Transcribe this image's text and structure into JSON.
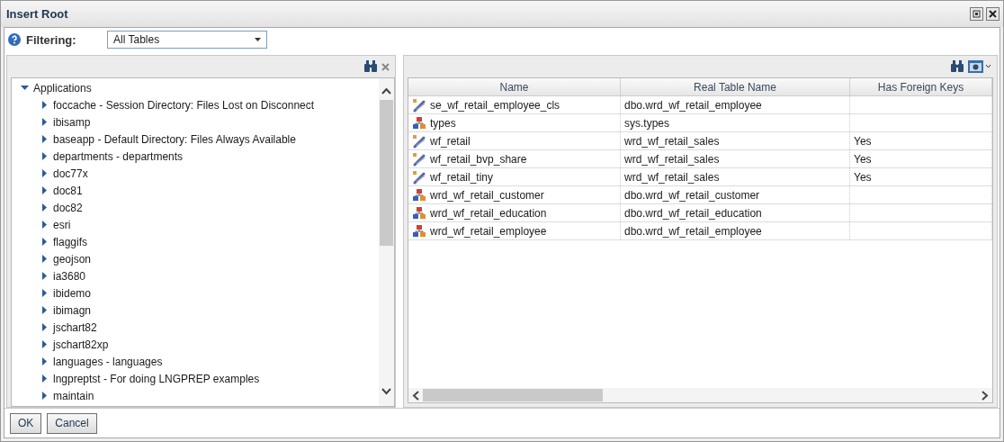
{
  "window": {
    "title": "Insert Root"
  },
  "filter": {
    "label": "Filtering:",
    "value": "All Tables"
  },
  "tree": [
    {
      "label": "Applications",
      "expanded": true,
      "children": [
        {
          "label": "foccache - Session Directory: Files Lost on Disconnect",
          "expanded": false
        },
        {
          "label": "ibisamp",
          "expanded": false
        },
        {
          "label": "baseapp - Default Directory: Files Always Available",
          "expanded": false
        },
        {
          "label": "departments - departments",
          "expanded": false
        },
        {
          "label": "doc77x",
          "expanded": false
        },
        {
          "label": "doc81",
          "expanded": false
        },
        {
          "label": "doc82",
          "expanded": false
        },
        {
          "label": "esri",
          "expanded": false
        },
        {
          "label": "flaggifs",
          "expanded": false
        },
        {
          "label": "geojson",
          "expanded": false
        },
        {
          "label": "ia3680",
          "expanded": false
        },
        {
          "label": "ibidemo",
          "expanded": false
        },
        {
          "label": "ibimagn",
          "expanded": false
        },
        {
          "label": "jschart82",
          "expanded": false
        },
        {
          "label": "jschart82xp",
          "expanded": false
        },
        {
          "label": "languages - languages",
          "expanded": false
        },
        {
          "label": "lngpreptst - For doing LNGPREP examples",
          "expanded": false
        },
        {
          "label": "maintain",
          "expanded": false
        }
      ]
    }
  ],
  "table": {
    "columns": [
      "Name",
      "Real Table Name",
      "Has Foreign Keys"
    ],
    "rows": [
      {
        "kind": "link",
        "cells": [
          "se_wf_retail_employee_cls",
          "dbo.wrd_wf_retail_employee",
          ""
        ]
      },
      {
        "kind": "table",
        "cells": [
          "types",
          "sys.types",
          ""
        ]
      },
      {
        "kind": "link",
        "cells": [
          "wf_retail",
          "wrd_wf_retail_sales",
          "Yes"
        ]
      },
      {
        "kind": "link",
        "cells": [
          "wf_retail_bvp_share",
          "wrd_wf_retail_sales",
          "Yes"
        ]
      },
      {
        "kind": "link",
        "cells": [
          "wf_retail_tiny",
          "wrd_wf_retail_sales",
          "Yes"
        ]
      },
      {
        "kind": "table",
        "cells": [
          "wrd_wf_retail_customer",
          "dbo.wrd_wf_retail_customer",
          ""
        ]
      },
      {
        "kind": "table",
        "cells": [
          "wrd_wf_retail_education",
          "dbo.wrd_wf_retail_education",
          ""
        ]
      },
      {
        "kind": "table",
        "cells": [
          "wrd_wf_retail_employee",
          "dbo.wrd_wf_retail_employee",
          ""
        ]
      }
    ]
  },
  "buttons": [
    "OK",
    "Cancel"
  ]
}
